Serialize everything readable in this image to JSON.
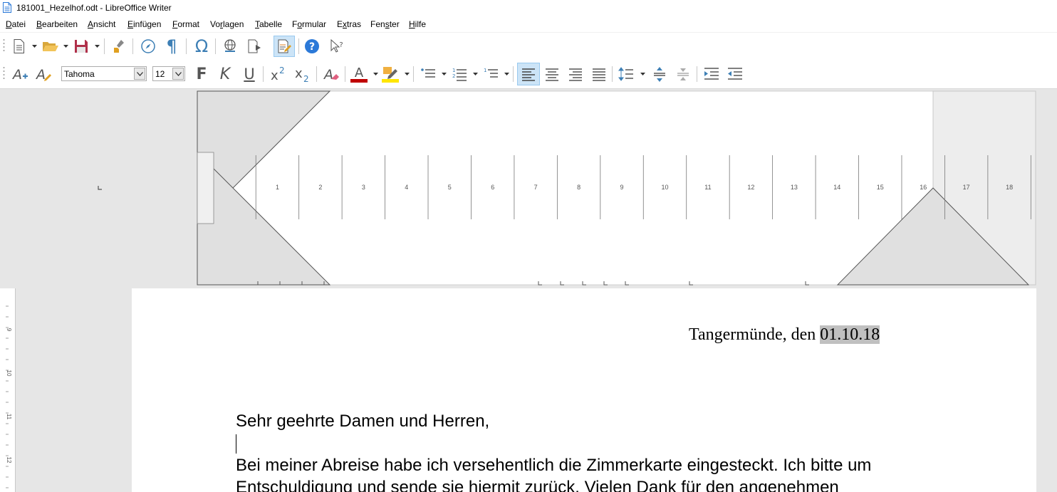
{
  "window": {
    "title": "181001_Hezelhof.odt - LibreOffice Writer"
  },
  "menu": [
    {
      "pre": "",
      "u": "D",
      "post": "atei"
    },
    {
      "pre": "",
      "u": "B",
      "post": "earbeiten"
    },
    {
      "pre": "",
      "u": "A",
      "post": "nsicht"
    },
    {
      "pre": "",
      "u": "E",
      "post": "infügen"
    },
    {
      "pre": "",
      "u": "F",
      "post": "ormat"
    },
    {
      "pre": "Vo",
      "u": "r",
      "post": "lagen"
    },
    {
      "pre": "",
      "u": "T",
      "post": "abelle"
    },
    {
      "pre": "F",
      "u": "o",
      "post": "rmular"
    },
    {
      "pre": "E",
      "u": "x",
      "post": "tras"
    },
    {
      "pre": "Fen",
      "u": "s",
      "post": "ter"
    },
    {
      "pre": "",
      "u": "H",
      "post": "ilfe"
    }
  ],
  "formatting": {
    "font_name": "Tahoma",
    "font_size": "12",
    "bold_glyph": "F",
    "italic_glyph": "K",
    "underline_glyph": "U",
    "align_left_active": true
  },
  "colors": {
    "font_color": "#c00000",
    "highlight_color": "#ffe600",
    "accent": "#2b79d8",
    "date_field_shade": "#c0c0c0"
  },
  "ruler": {
    "numbers": [
      "1",
      "2",
      "3",
      "4",
      "5",
      "6",
      "7",
      "8",
      "9",
      "10",
      "11",
      "12",
      "13",
      "14",
      "15",
      "16",
      "17",
      "18"
    ]
  },
  "vruler": {
    "numbers": [
      "9",
      "10",
      "11",
      "12"
    ]
  },
  "document": {
    "date_prefix": "Tangermünde, den ",
    "date_value": "01.10.18",
    "salutation": "Sehr geehrte Damen und Herren,",
    "paragraph_line1": "Bei meiner Abreise habe ich versehentlich die Zimmerkarte eingesteckt. Ich bitte um",
    "paragraph_line2": "Entschuldigung und sende sie hiermit zurück. Vielen Dank für den angenehmen"
  }
}
